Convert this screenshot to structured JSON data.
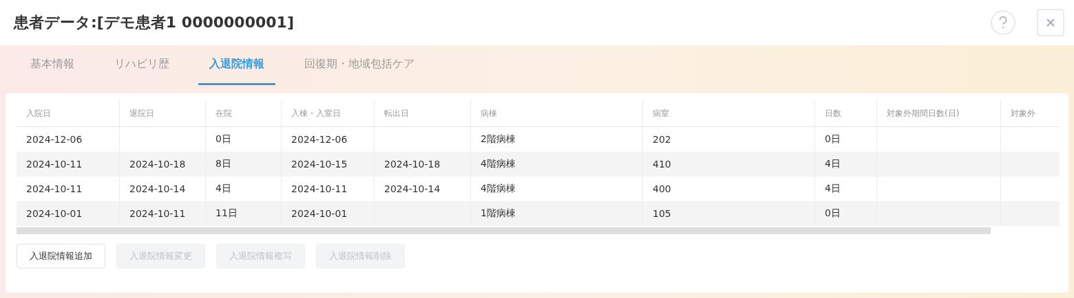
{
  "window": {
    "title": "患者データ:[デモ患者1 0000000001]"
  },
  "tabs": [
    {
      "label": "基本情報",
      "selected": false
    },
    {
      "label": "リハビリ歴",
      "selected": false
    },
    {
      "label": "入退院情報",
      "selected": true
    },
    {
      "label": "回復期・地域包括ケア",
      "selected": false
    }
  ],
  "table": {
    "columns": [
      "入院日",
      "退院日",
      "在院",
      "入棟・入室日",
      "転出日",
      "病棟",
      "病室",
      "日数",
      "対象外期間日数(日)",
      "対象外"
    ],
    "rows": [
      [
        "2024-12-06",
        "",
        "0日",
        "2024-12-06",
        "",
        "2階病棟",
        "202",
        "0日",
        "",
        ""
      ],
      [
        "2024-10-11",
        "2024-10-18",
        "8日",
        "2024-10-15",
        "2024-10-18",
        "4階病棟",
        "410",
        "4日",
        "",
        ""
      ],
      [
        "2024-10-11",
        "2024-10-14",
        "4日",
        "2024-10-11",
        "2024-10-14",
        "4階病棟",
        "400",
        "4日",
        "",
        ""
      ],
      [
        "2024-10-01",
        "2024-10-11",
        "11日",
        "2024-10-01",
        "",
        "1階病棟",
        "105",
        "0日",
        "",
        ""
      ]
    ]
  },
  "buttons": [
    {
      "label": "入退院情報追加",
      "disabled": false
    },
    {
      "label": "入退院情報変更",
      "disabled": true
    },
    {
      "label": "入退院情報複写",
      "disabled": true
    },
    {
      "label": "入退院情報削除",
      "disabled": true
    }
  ]
}
